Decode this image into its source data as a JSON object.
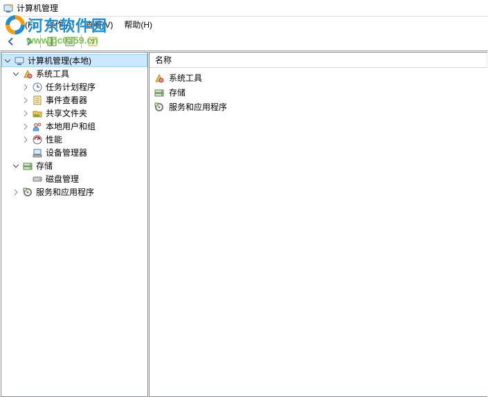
{
  "watermark": {
    "brand": "河东软件园",
    "url": "www.pc0359.cn"
  },
  "titlebar": {
    "title": "计算机管理"
  },
  "menubar": {
    "file": "文件(F)",
    "action": "操作(A)",
    "view": "查看(V)",
    "help": "帮助(H)"
  },
  "toolbar": {
    "back": "后退",
    "forward": "前进",
    "up": "上一级",
    "show_hide": "显示/隐藏控制台树",
    "properties": "属性",
    "help": "帮助"
  },
  "tree": {
    "root": "计算机管理(本地)",
    "system_tools": "系统工具",
    "task_scheduler": "任务计划程序",
    "event_viewer": "事件查看器",
    "shared_folders": "共享文件夹",
    "local_users": "本地用户和组",
    "performance": "性能",
    "device_manager": "设备管理器",
    "storage": "存储",
    "disk_management": "磁盘管理",
    "services_apps": "服务和应用程序"
  },
  "list": {
    "header_name": "名称",
    "items": [
      {
        "label": "系统工具",
        "icon": "system-tools"
      },
      {
        "label": "存储",
        "icon": "storage"
      },
      {
        "label": "服务和应用程序",
        "icon": "services"
      }
    ]
  }
}
